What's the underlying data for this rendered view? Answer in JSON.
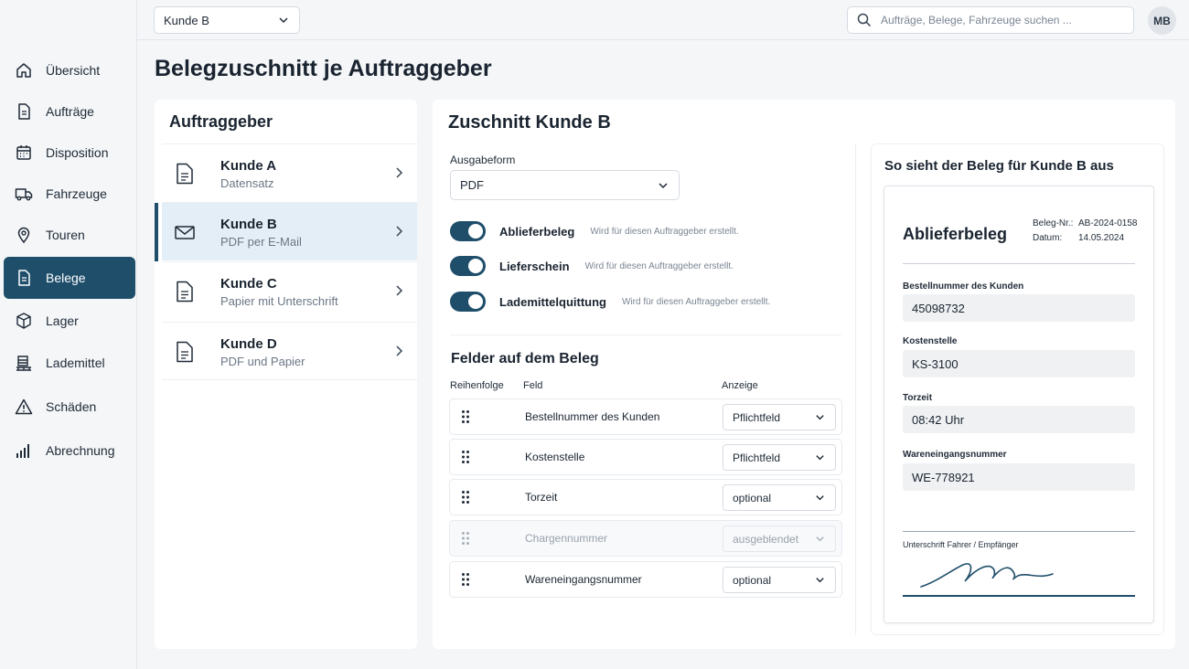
{
  "header": {
    "client_select": "Kunde B",
    "search_placeholder": "Aufträge, Belege, Fahrzeuge suchen ...",
    "avatar_initials": "MB"
  },
  "sidebar": {
    "items": [
      {
        "label": "Übersicht",
        "icon": "home-icon"
      },
      {
        "label": "Aufträge",
        "icon": "document-icon"
      },
      {
        "label": "Disposition",
        "icon": "calendar-icon"
      },
      {
        "label": "Fahrzeuge",
        "icon": "truck-icon"
      },
      {
        "label": "Touren",
        "icon": "location-pin-icon"
      },
      {
        "label": "Belege",
        "icon": "receipt-icon",
        "active": true
      },
      {
        "label": "Lager",
        "icon": "box-icon"
      },
      {
        "label": "Lademittel",
        "icon": "pallet-icon"
      },
      {
        "label": "Schäden",
        "icon": "warning-icon"
      },
      {
        "label": "Abrechnung",
        "icon": "bar-chart-icon"
      }
    ]
  },
  "page": {
    "title": "Belegzuschnitt je Auftraggeber"
  },
  "clients": {
    "title": "Auftraggeber",
    "items": [
      {
        "name": "Kunde A",
        "sub": "Datensatz",
        "icon": "document-icon"
      },
      {
        "name": "Kunde B",
        "sub": "PDF per E-Mail",
        "icon": "mail-icon",
        "active": true
      },
      {
        "name": "Kunde C",
        "sub": "Papier mit Unterschrift",
        "icon": "document-icon"
      },
      {
        "name": "Kunde D",
        "sub": "PDF und Papier",
        "icon": "document-icon"
      }
    ]
  },
  "config": {
    "title": "Zuschnitt Kunde B",
    "format_label": "Ausgabeform",
    "format_value": "PDF",
    "toggles": [
      {
        "name": "Ablieferbeleg",
        "desc": "Wird für diesen Auftraggeber erstellt.",
        "on": true
      },
      {
        "name": "Lieferschein",
        "desc": "Wird für diesen Auftraggeber erstellt.",
        "on": true
      },
      {
        "name": "Lademittelquittung",
        "desc": "Wird für diesen Auftraggeber erstellt.",
        "on": true
      }
    ],
    "fields_title": "Felder auf dem Beleg",
    "col_order": "Reihenfolge",
    "col_field": "Feld",
    "col_display": "Anzeige",
    "fields": [
      {
        "name": "Bestellnummer des Kunden",
        "display": "Pflichtfeld"
      },
      {
        "name": "Kostenstelle",
        "display": "Pflichtfeld"
      },
      {
        "name": "Torzeit",
        "display": "optional"
      },
      {
        "name": "Chargennummer",
        "display": "ausgeblendet",
        "disabled": true
      },
      {
        "name": "Wareneingangsnummer",
        "display": "optional"
      }
    ]
  },
  "preview": {
    "title": "So sieht der Beleg für Kunde B aus",
    "doc_title": "Ablieferbeleg",
    "beleg_label": "Beleg-Nr.:",
    "beleg_value": "AB-2024-0158",
    "date_label": "Datum:",
    "date_value": "14.05.2024",
    "fields": [
      {
        "label": "Bestellnummer des Kunden",
        "value": "45098732"
      },
      {
        "label": "Kostenstelle",
        "value": "KS-3100"
      },
      {
        "label": "Torzeit",
        "value": "08:42 Uhr"
      },
      {
        "label": "Wareneingangsnummer",
        "value": "WE-778921"
      }
    ],
    "signature_label": "Unterschrift Fahrer / Empfänger"
  },
  "colors": {
    "accent": "#1f4e6b",
    "active_row": "#e3eef6"
  }
}
